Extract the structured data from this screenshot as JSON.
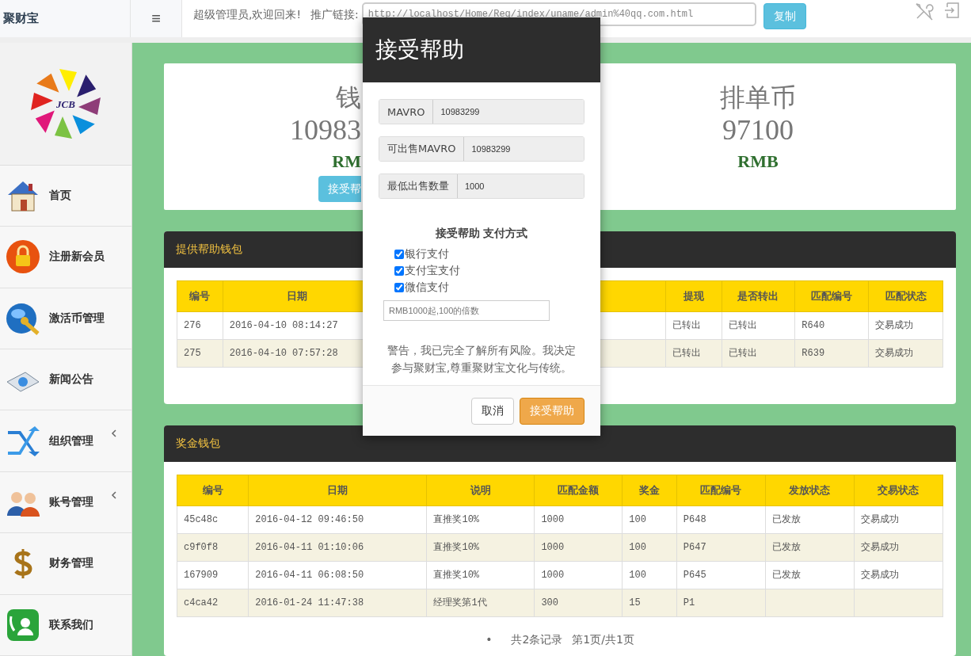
{
  "header": {
    "brand": "聚财宝",
    "menu_glyph": "≡",
    "welcome": "超级管理员,欢迎回来!",
    "link_label": "推广链接:",
    "link_value": "http://localhost/Home/Reg/index/uname/admin%40qq.com.html",
    "copy_button": "复制"
  },
  "sidebar": {
    "logo_text": "JCB",
    "items": [
      {
        "label": "首页",
        "kind": "house",
        "expandable": false
      },
      {
        "label": "注册新会员",
        "kind": "lock",
        "expandable": false
      },
      {
        "label": "激活币管理",
        "kind": "key",
        "expandable": false
      },
      {
        "label": "新闻公告",
        "kind": "news",
        "expandable": false
      },
      {
        "label": "组织管理",
        "kind": "arrows",
        "expandable": true
      },
      {
        "label": "账号管理",
        "kind": "people",
        "expandable": true
      },
      {
        "label": "财务管理",
        "kind": "dollar",
        "expandable": false
      },
      {
        "label": "联系我们",
        "kind": "phone",
        "expandable": false
      }
    ]
  },
  "summary": {
    "wallet": {
      "title": "钱",
      "amount": "10983",
      "unit": "RM",
      "button": "接受帮"
    },
    "queue": {
      "title": "排单币",
      "amount": "97100",
      "unit": "RMB"
    }
  },
  "help_wallet": {
    "title": "提供帮助钱包",
    "columns": [
      "编号",
      "日期",
      "提现",
      "是否转出",
      "匹配编号",
      "匹配状态"
    ],
    "rows": [
      [
        "276",
        "2016-04-10 08:14:27",
        "已转出",
        "已转出",
        "R640",
        "交易成功"
      ],
      [
        "275",
        "2016-04-10 07:57:28",
        "已转出",
        "已转出",
        "R639",
        "交易成功"
      ]
    ]
  },
  "bonus_wallet": {
    "title": "奖金钱包",
    "columns": [
      "编号",
      "日期",
      "说明",
      "匹配金额",
      "奖金",
      "匹配编号",
      "发放状态",
      "交易状态"
    ],
    "rows": [
      [
        "45c48c",
        "2016-04-12 09:46:50",
        "直推奖10%",
        "1000",
        "100",
        "P648",
        "已发放",
        "交易成功"
      ],
      [
        "c9f0f8",
        "2016-04-11 01:10:06",
        "直推奖10%",
        "1000",
        "100",
        "P647",
        "已发放",
        "交易成功"
      ],
      [
        "167909",
        "2016-04-11 06:08:50",
        "直推奖10%",
        "1000",
        "100",
        "P645",
        "已发放",
        "交易成功"
      ],
      [
        "c4ca42",
        "2016-01-24 11:47:38",
        "经理奖第1代",
        "300",
        "15",
        "P1",
        "",
        ""
      ]
    ],
    "pagination": {
      "bullet": "•",
      "records": "共2条记录",
      "pages": "第1页/共1页"
    }
  },
  "modal": {
    "title": "接受帮助",
    "fields": [
      {
        "label": "MAVRO",
        "value": "10983299"
      },
      {
        "label": "可出售MAVRO",
        "value": "10983299"
      },
      {
        "label": "最低出售数量",
        "value": "1000"
      }
    ],
    "payment_title": "接受帮助 支付方式",
    "payment_options": [
      {
        "label": "银行支付",
        "checked": true
      },
      {
        "label": "支付宝支付",
        "checked": true
      },
      {
        "label": "微信支付",
        "checked": true
      }
    ],
    "amount_placeholder": "RMB1000起,100的倍数",
    "warning": "警告，我已完全了解所有风险。我决定参与聚财宝,尊重聚财宝文化与传统。",
    "cancel": "取消",
    "confirm": "接受帮助"
  }
}
